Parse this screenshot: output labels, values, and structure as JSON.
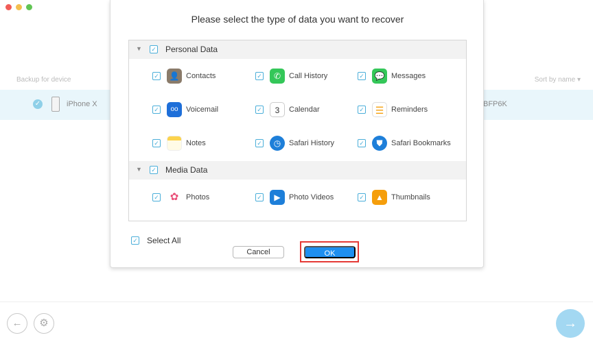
{
  "background": {
    "list_header_left": "Backup for device",
    "list_header_right": "Sort by name ▾",
    "device_name": "iPhone X",
    "device_serial_fragment": "BFP6K"
  },
  "dialog": {
    "title": "Please select the type of data you want to recover",
    "sections": [
      {
        "label": "Personal Data",
        "checked": true,
        "items": [
          {
            "label": "Contacts",
            "icon": "contacts-icon",
            "checked": true,
            "color": "#8a7b6a"
          },
          {
            "label": "Call History",
            "icon": "phone-icon",
            "checked": true,
            "color": "#34c759"
          },
          {
            "label": "Messages",
            "icon": "messages-icon",
            "checked": true,
            "color": "#34c759"
          },
          {
            "label": "Voicemail",
            "icon": "voicemail-icon",
            "checked": true,
            "color": "#1e6fd9"
          },
          {
            "label": "Calendar",
            "icon": "calendar-icon",
            "checked": true,
            "color": "#ffffff",
            "icon_text": "3"
          },
          {
            "label": "Reminders",
            "icon": "reminders-icon",
            "checked": true,
            "color": "#ffffff"
          },
          {
            "label": "Notes",
            "icon": "notes-icon",
            "checked": true,
            "color": "#fcd34d"
          },
          {
            "label": "Safari History",
            "icon": "safari-history-icon",
            "checked": true,
            "color": "#1e7fd9"
          },
          {
            "label": "Safari Bookmarks",
            "icon": "safari-bookmarks-icon",
            "checked": true,
            "color": "#1e7fd9"
          }
        ]
      },
      {
        "label": "Media Data",
        "checked": true,
        "items": [
          {
            "label": "Photos",
            "icon": "photos-icon",
            "checked": true,
            "color": "#ffffff"
          },
          {
            "label": "Photo Videos",
            "icon": "photo-videos-icon",
            "checked": true,
            "color": "#1e7fd9"
          },
          {
            "label": "Thumbnails",
            "icon": "thumbnails-icon",
            "checked": true,
            "color": "#f59e0b"
          }
        ]
      }
    ],
    "select_all_label": "Select All",
    "cancel_label": "Cancel",
    "ok_label": "OK"
  },
  "colors": {
    "accent": "#1e8ff0",
    "checkbox": "#4aaed9",
    "highlight": "#e53935",
    "row_highlight": "#e9f6fb"
  }
}
